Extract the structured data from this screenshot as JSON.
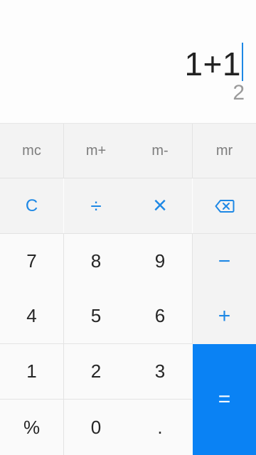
{
  "display": {
    "expression": "1+1",
    "result": "2"
  },
  "memory_row": [
    "mc",
    "m+",
    "m-",
    "mr"
  ],
  "operator_row": {
    "clear": "C",
    "divide": "÷",
    "multiply": "×"
  },
  "digits": {
    "seven": "7",
    "eight": "8",
    "nine": "9",
    "four": "4",
    "five": "5",
    "six": "6",
    "one": "1",
    "two": "2",
    "three": "3",
    "percent": "%",
    "zero": "0",
    "dot": "."
  },
  "side_ops": {
    "minus": "−",
    "plus": "+",
    "equals": "="
  },
  "colors": {
    "accent": "#1e88e5",
    "equals_bg": "#0a82f4"
  },
  "icons": {
    "backspace": "backspace-icon"
  }
}
